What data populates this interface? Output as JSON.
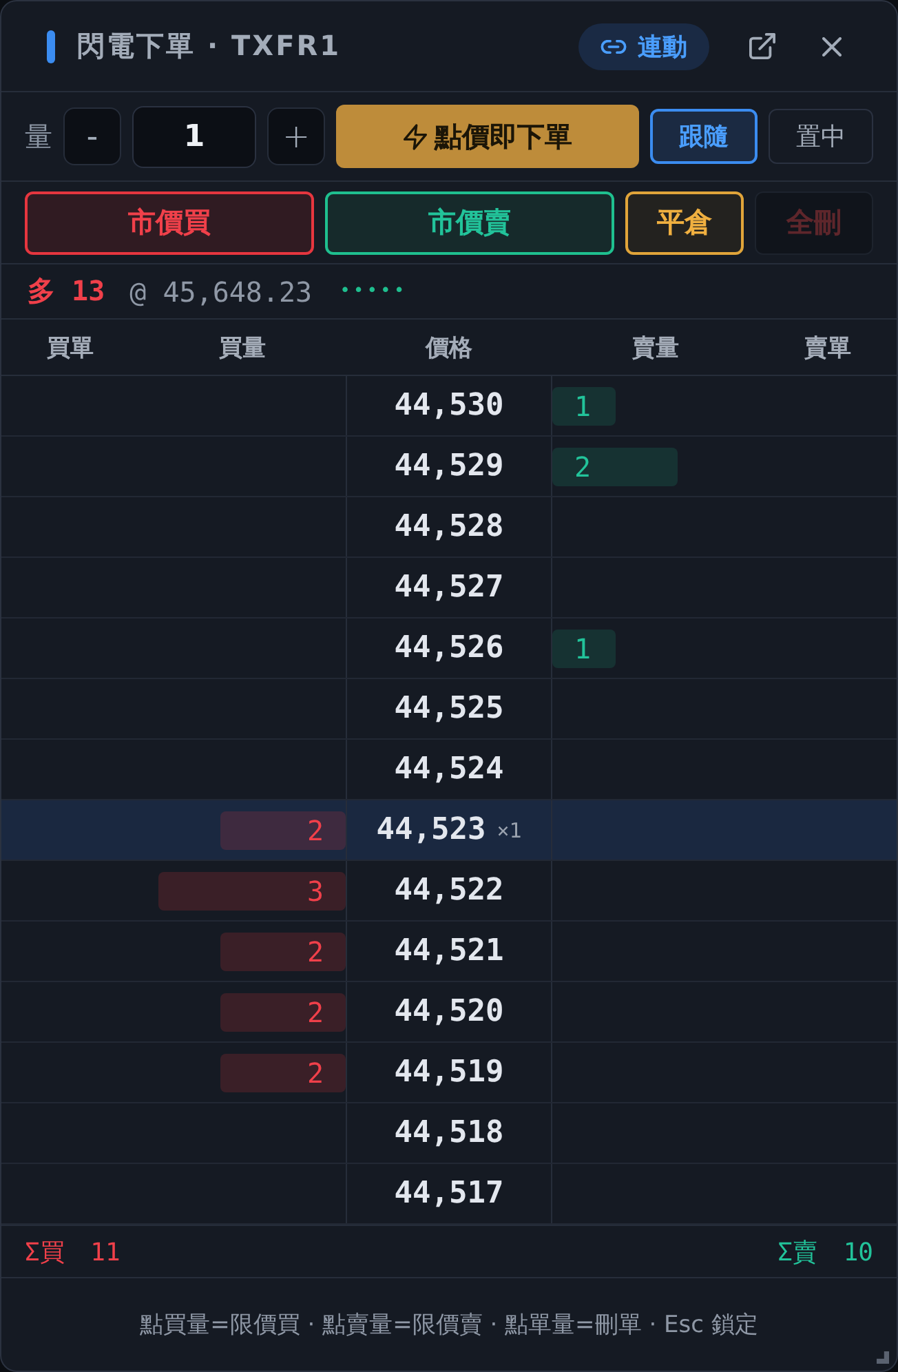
{
  "window": {
    "title": "閃電下單 · TXFR1",
    "link_button": "連動"
  },
  "quantity": {
    "label": "量",
    "decrement": "-",
    "value": "1",
    "increment": "+"
  },
  "order_button": {
    "label": "點價即下單"
  },
  "toggles": [
    {
      "label": "跟隨",
      "on": true
    },
    {
      "label": "置中",
      "on": false
    }
  ],
  "actions": [
    {
      "label": "市價買",
      "kind": "buy",
      "disabled": false
    },
    {
      "label": "市價賣",
      "kind": "sell",
      "disabled": false
    },
    {
      "label": "平倉",
      "kind": "close",
      "disabled": false
    },
    {
      "label": "全刪",
      "kind": "cancel",
      "disabled": true
    }
  ],
  "position": {
    "label": "多 13",
    "price": "@ 45,648.23",
    "dots": "•••••"
  },
  "ladder": {
    "columns": [
      "買單",
      "買量",
      "價格",
      "賣量",
      "賣單"
    ],
    "rows": [
      {
        "price": "44,530",
        "current": false,
        "sell_qty": "1"
      },
      {
        "price": "44,529",
        "current": false,
        "sell_qty": "2"
      },
      {
        "price": "44,528",
        "current": false
      },
      {
        "price": "44,527",
        "current": false
      },
      {
        "price": "44,526",
        "current": false,
        "sell_qty": "1"
      },
      {
        "price": "44,525",
        "current": false
      },
      {
        "price": "44,524",
        "current": false
      },
      {
        "price": "44,523",
        "current": true,
        "suffix": "×1",
        "buy_qty": "2"
      },
      {
        "price": "44,522",
        "current": false,
        "buy_qty": "3"
      },
      {
        "price": "44,521",
        "current": false,
        "buy_qty": "2"
      },
      {
        "price": "44,520",
        "current": false,
        "buy_qty": "2"
      },
      {
        "price": "44,519",
        "current": false,
        "buy_qty": "2"
      },
      {
        "price": "44,518",
        "current": false
      },
      {
        "price": "44,517",
        "current": false
      }
    ]
  },
  "totals": {
    "buy": "Σ買 11",
    "sell": "Σ賣 10"
  },
  "hint": "點買量=限價買 · 點賣量=限價賣 · 點單量=刪單 · Esc 鎖定"
}
